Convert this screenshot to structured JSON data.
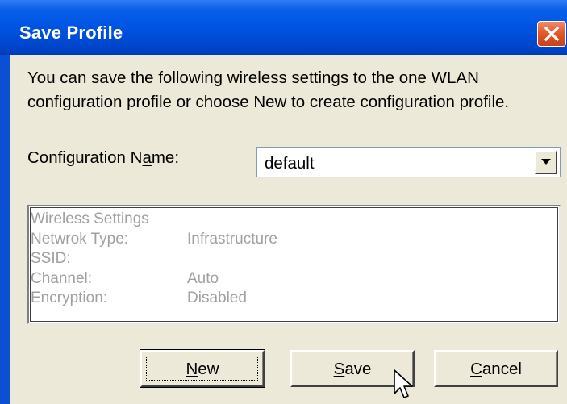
{
  "window": {
    "title": "Save Profile"
  },
  "intro": {
    "line1": "You can save the following wireless settings to the one WLAN",
    "line2": "configuration profile or choose New to create configuration profile."
  },
  "config": {
    "label_before": "Configuration N",
    "label_underlined": "a",
    "label_after": "me:",
    "selected_value": "default"
  },
  "settings": {
    "heading": "Wireless Settings",
    "rows": [
      {
        "label": "Netwrok Type:",
        "value": "Infrastructure"
      },
      {
        "label": "SSID:",
        "value": ""
      },
      {
        "label": "Channel:",
        "value": "Auto"
      },
      {
        "label": "Encryption:",
        "value": "Disabled"
      }
    ]
  },
  "buttons": {
    "new_mnemonic": "N",
    "new_rest": "ew",
    "save_mnemonic": "S",
    "save_rest": "ave",
    "cancel_mnemonic": "C",
    "cancel_rest": "ancel"
  },
  "icons": {
    "close": "close-icon",
    "dropdown": "chevron-down-icon",
    "cursor": "mouse-pointer-icon"
  },
  "colors": {
    "titlebar": "#0055e5",
    "close_button": "#e35a2c",
    "face": "#ece9d8",
    "disabled_text": "#a0a0a0"
  }
}
